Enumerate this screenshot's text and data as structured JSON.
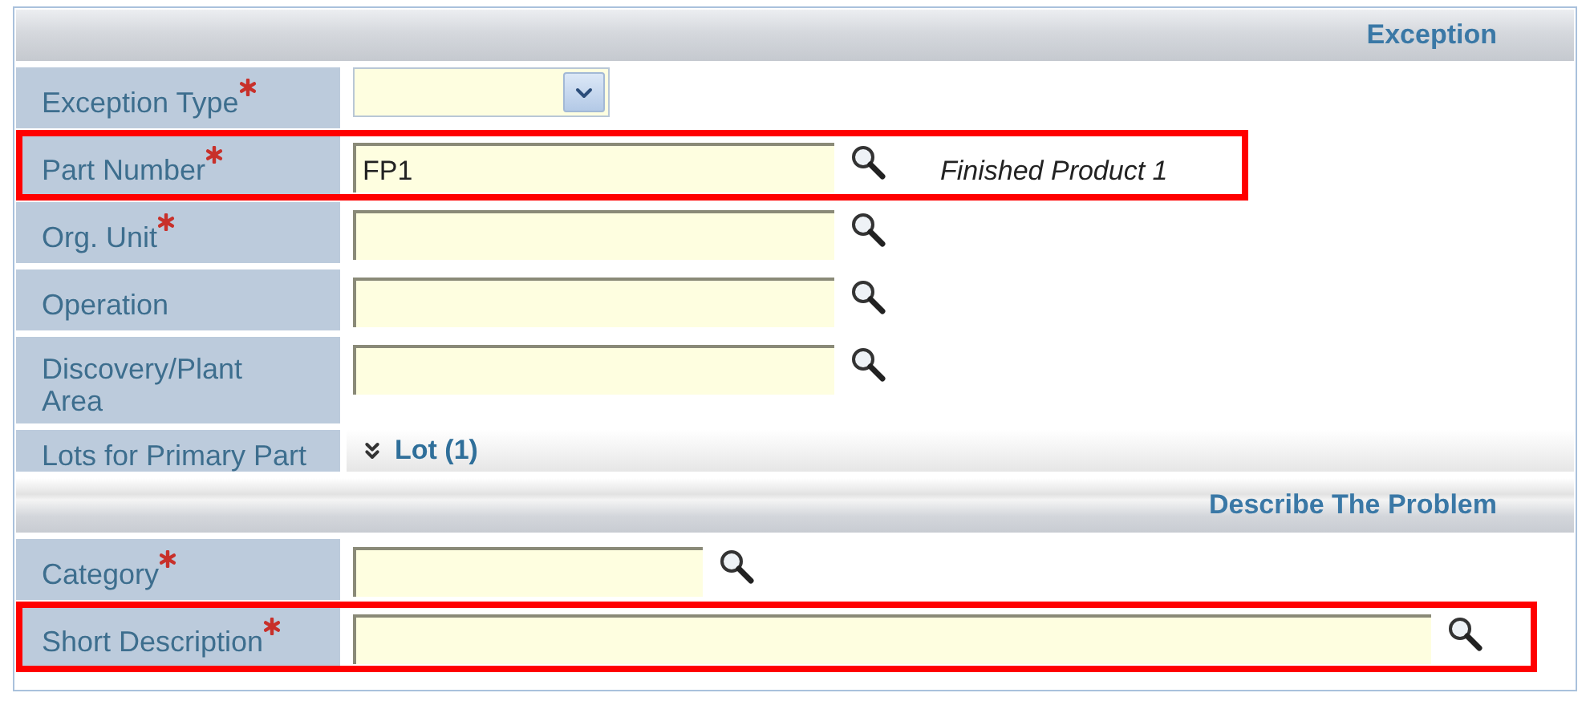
{
  "sections": [
    {
      "title": "Exception",
      "rows": [
        {
          "label": "Exception Type",
          "required": true,
          "kind": "select",
          "highlighted": false
        },
        {
          "label": "Part Number",
          "required": true,
          "kind": "lookup",
          "value": "FP1",
          "note": "Finished Product 1",
          "highlighted": true
        },
        {
          "label": "Org. Unit",
          "required": true,
          "kind": "lookup",
          "highlighted": false
        },
        {
          "label": "Operation",
          "required": false,
          "kind": "lookup",
          "highlighted": false
        },
        {
          "label": "Discovery/Plant Area",
          "required": false,
          "kind": "lookup",
          "highlighted": false
        },
        {
          "label": "Lots for Primary Part",
          "required": false,
          "kind": "expander",
          "link": "Lot (1)",
          "highlighted": false
        }
      ]
    },
    {
      "title": "Describe The Problem",
      "rows": [
        {
          "label": "Category",
          "required": true,
          "kind": "lookup",
          "highlighted": false
        },
        {
          "label": "Short Description",
          "required": true,
          "kind": "lookup",
          "highlighted": true
        }
      ]
    }
  ]
}
